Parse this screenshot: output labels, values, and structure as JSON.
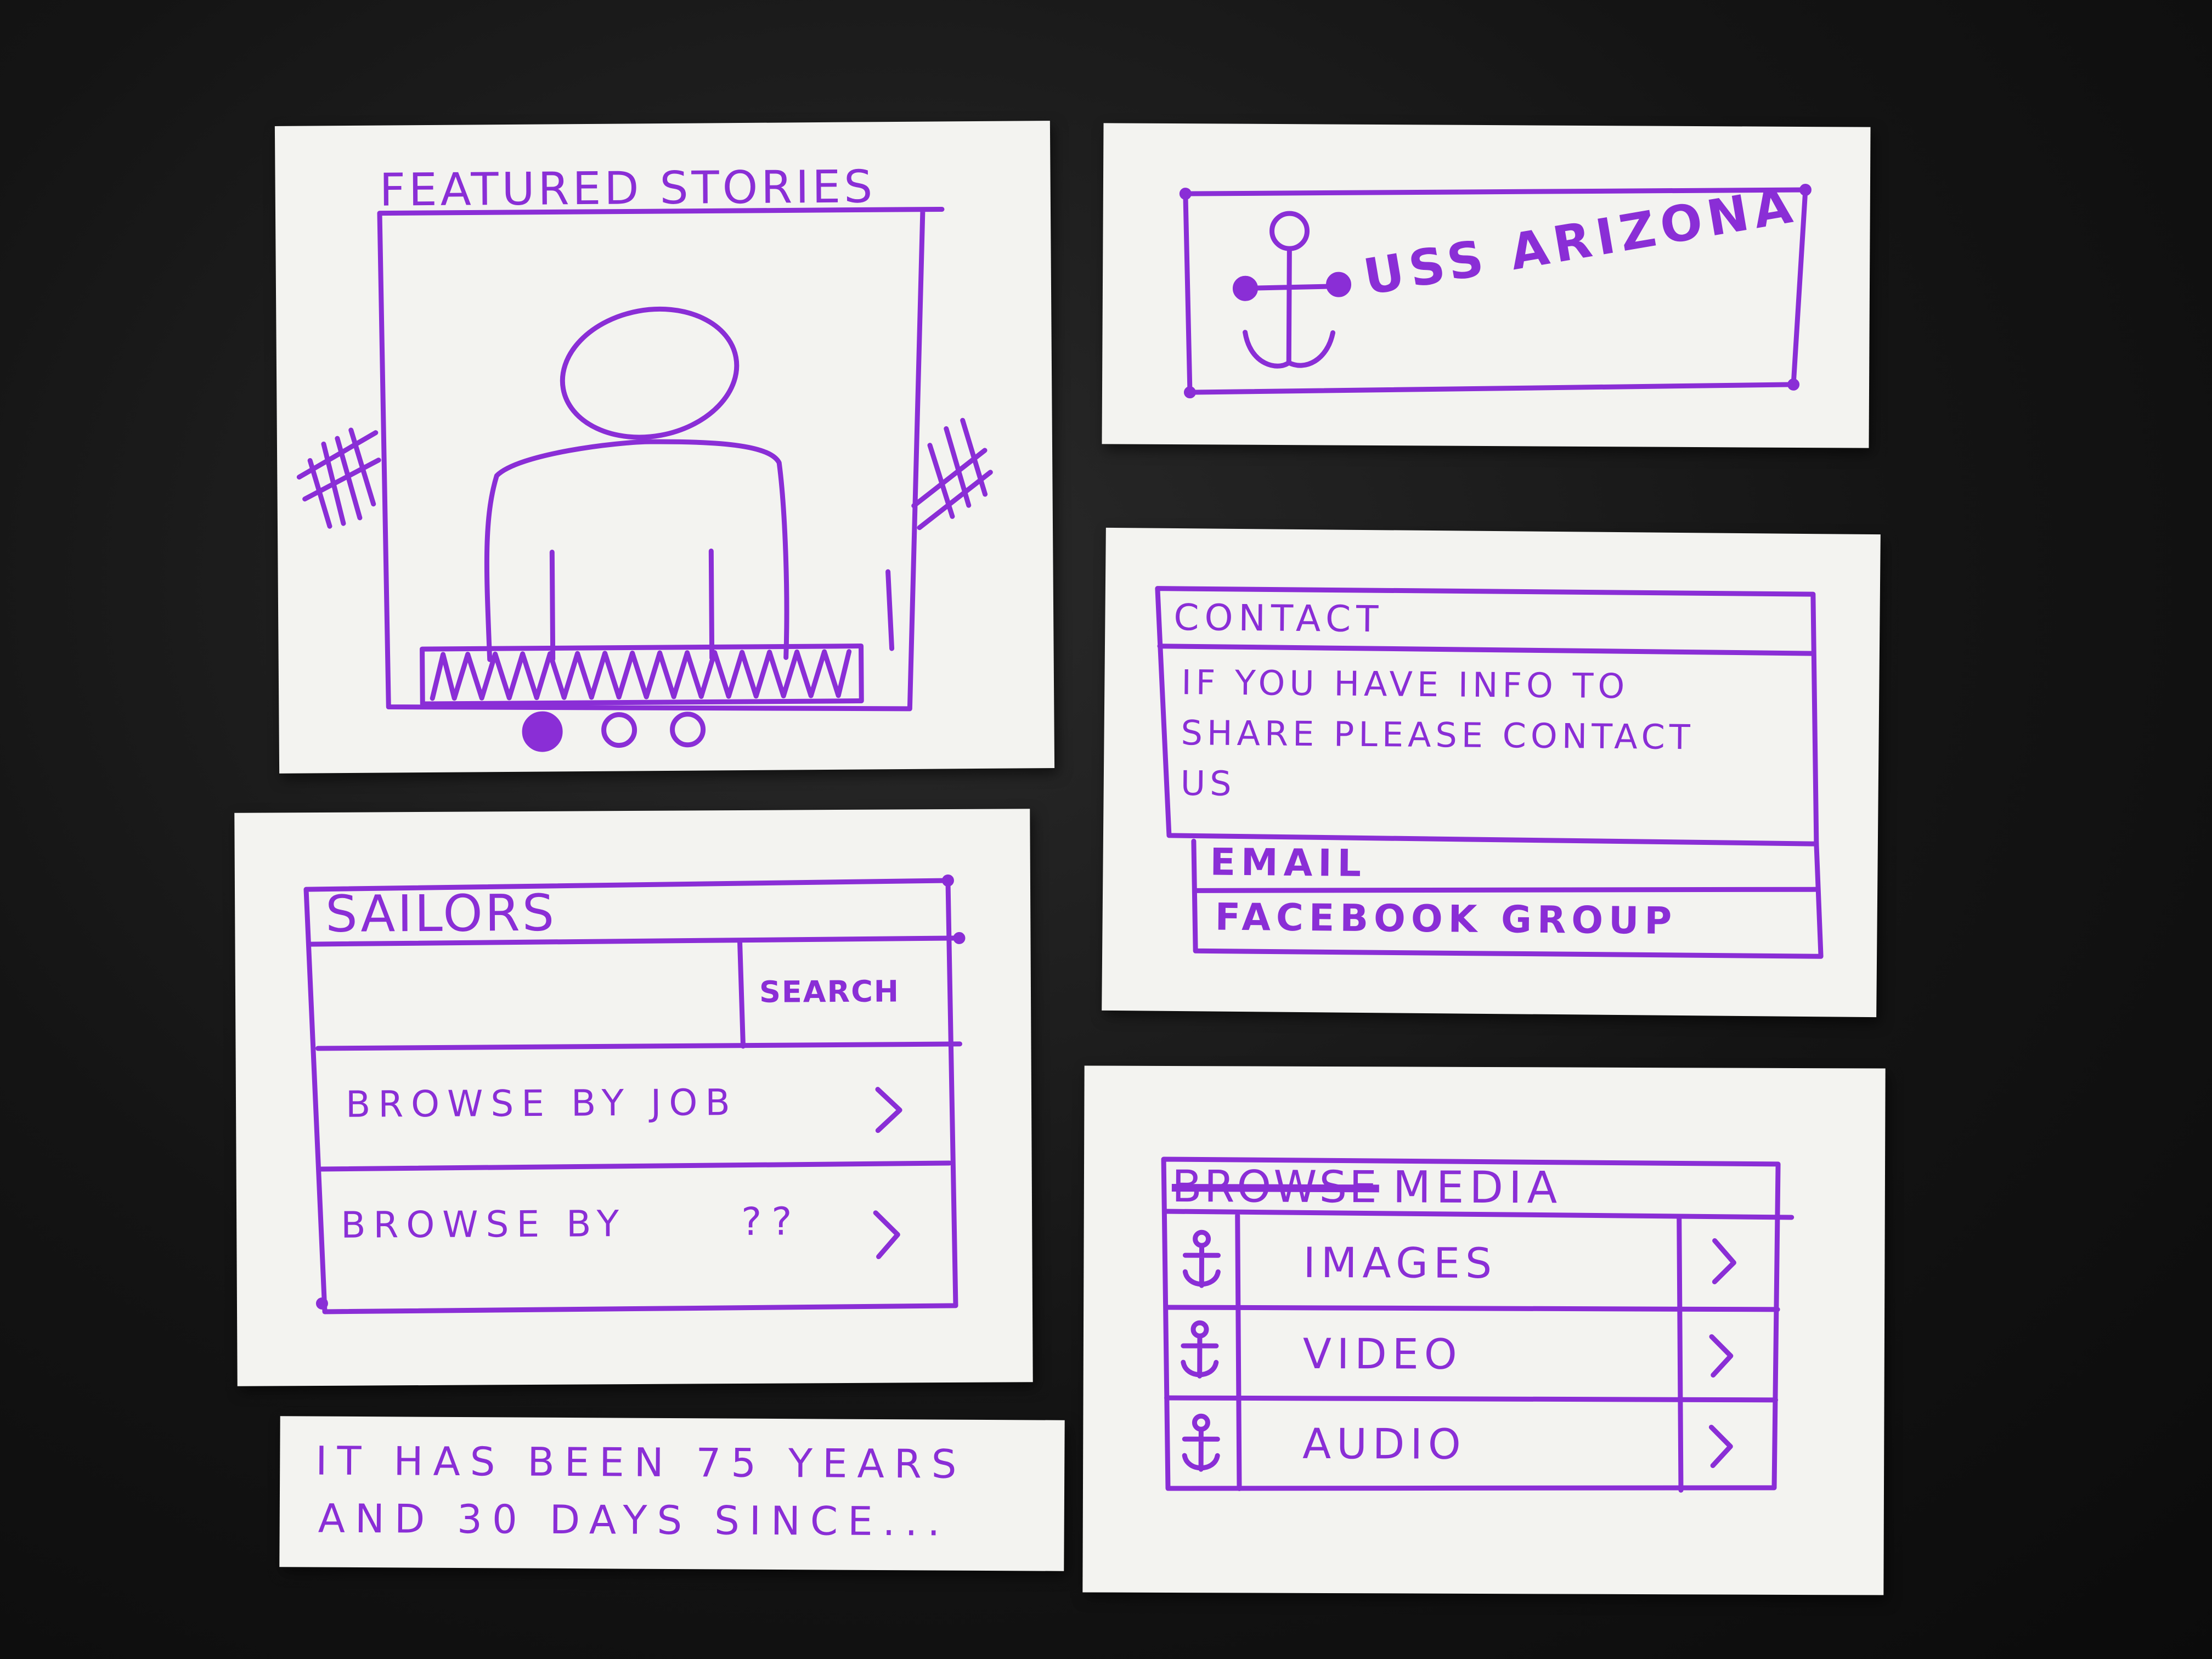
{
  "ink_color": "#8a2ed6",
  "featured": {
    "title": "FEATURED STORIES",
    "carousel_dots": [
      true,
      false,
      false
    ]
  },
  "banner": {
    "logo_icon": "anchor-icon",
    "title": "USS ARIZONA"
  },
  "contact": {
    "header": "CONTACT",
    "body_line1": "IF YOU HAVE INFO TO",
    "body_line2": "SHARE PLEASE CONTACT",
    "body_line3": "US",
    "email": "EMAIL",
    "facebook": "FACEBOOK GROUP"
  },
  "sailors": {
    "title": "SAILORS",
    "search_label": "SEARCH",
    "search_value": "",
    "rows": [
      {
        "label": "BROWSE BY JOB",
        "icon": "chevron-right-icon"
      },
      {
        "label": "BROWSE BY",
        "extra": "??",
        "icon": "chevron-right-icon"
      }
    ]
  },
  "media": {
    "title_struck": "BROWSE",
    "title": "MEDIA",
    "rows": [
      {
        "icon": "anchor-icon",
        "label": "IMAGES",
        "chevron": "chevron-right-icon"
      },
      {
        "icon": "anchor-icon",
        "label": "VIDEO",
        "chevron": "chevron-right-icon"
      },
      {
        "icon": "anchor-icon",
        "label": "AUDIO",
        "chevron": "chevron-right-icon"
      }
    ]
  },
  "counter": {
    "line1": "IT HAS BEEN 75 YEARS",
    "line2": "AND 30 DAYS SINCE..."
  }
}
